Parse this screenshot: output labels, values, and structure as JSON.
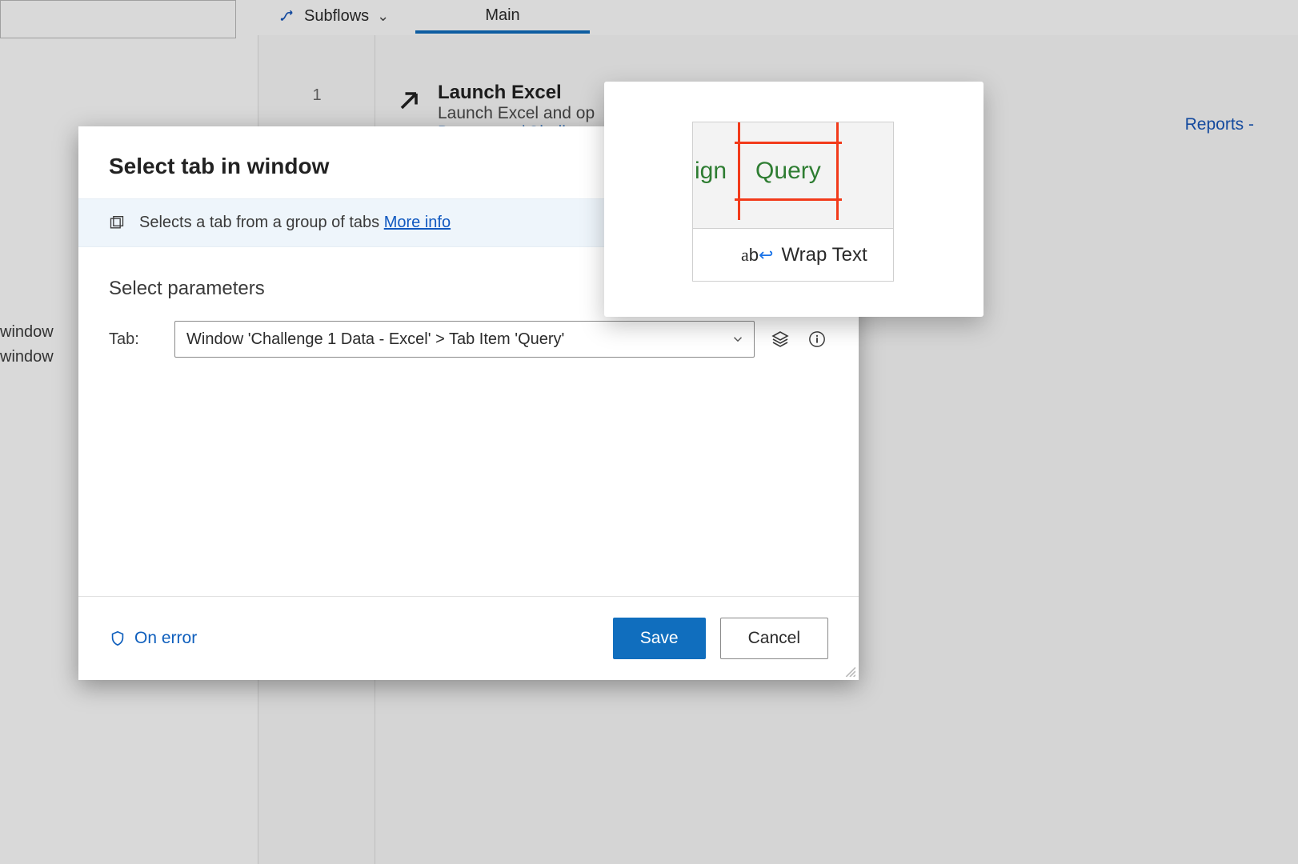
{
  "toolbar": {
    "subflows_label": "Subflows",
    "main_tab_label": "Main"
  },
  "flow": {
    "line1_number": "1",
    "step1_title": "Launch Excel",
    "step1_desc_prefix": "Launch Excel and op",
    "step1_path_fragment": "Documents\\Challenc",
    "reports_link": "Reports -"
  },
  "side": {
    "item_window": "window",
    "item_window2": "window"
  },
  "dialog": {
    "title": "Select tab in window",
    "description": "Selects a tab from a group of tabs",
    "more_info": "More info",
    "params_heading": "Select parameters",
    "tab_label": "Tab:",
    "tab_value": "Window 'Challenge 1 Data - Excel' > Tab Item 'Query'",
    "on_error": "On error",
    "save": "Save",
    "cancel": "Cancel"
  },
  "preview": {
    "fragment_left": "ign",
    "highlight_label": "Query",
    "wrap_text": "Wrap Text"
  }
}
